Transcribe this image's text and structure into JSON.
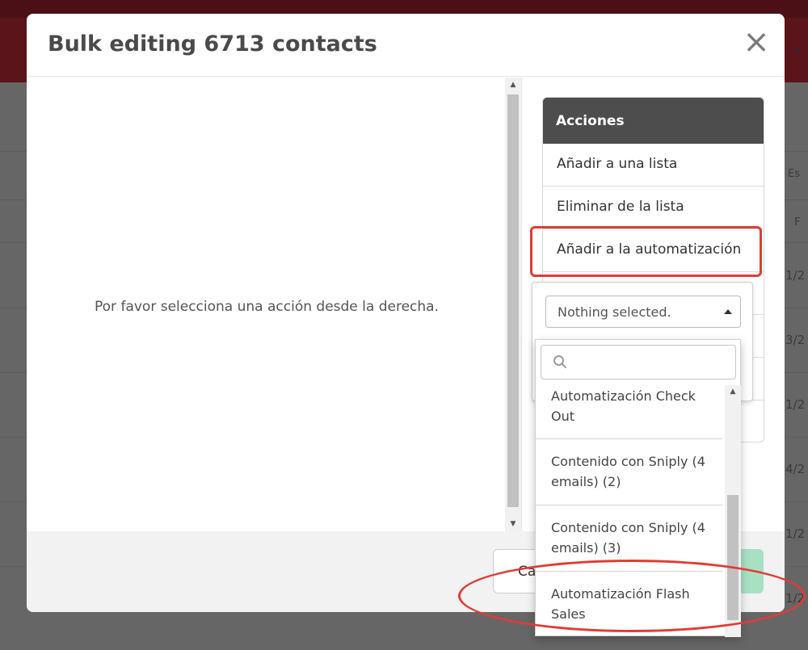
{
  "background": {
    "columns": [
      "Es",
      "F"
    ],
    "row_cells": [
      "1/2",
      "3/2",
      "1/2",
      "4/2",
      "1/2",
      "1/2"
    ]
  },
  "modal": {
    "title": "Bulk editing 6713 contacts",
    "close_symbol": "×",
    "placeholder": "Por favor selecciona una acción desde la derecha.",
    "footer": {
      "cancel_label": "Cancelar"
    }
  },
  "actions": {
    "header": "Acciones",
    "items": [
      {
        "label": "Añadir a una lista"
      },
      {
        "label": "Eliminar de la lista"
      },
      {
        "label": "Añadir a la automatización"
      }
    ]
  },
  "select": {
    "value": "Nothing selected.",
    "search_placeholder": "",
    "options": [
      {
        "label": "Automatización Check Out"
      },
      {
        "label": "Contenido con Sniply (4 emails) (2)"
      },
      {
        "label": "Contenido con Sniply (4 emails) (3)"
      },
      {
        "label": "Automatización Flash Sales"
      }
    ]
  },
  "colors": {
    "topbar": "#5b1419",
    "actions_header": "#4d4d4d",
    "highlight": "#e53935",
    "apply_button": "#a8e0c4"
  },
  "icons": {
    "close": "close-icon",
    "search": "search-icon",
    "caret": "caret-up-icon"
  }
}
